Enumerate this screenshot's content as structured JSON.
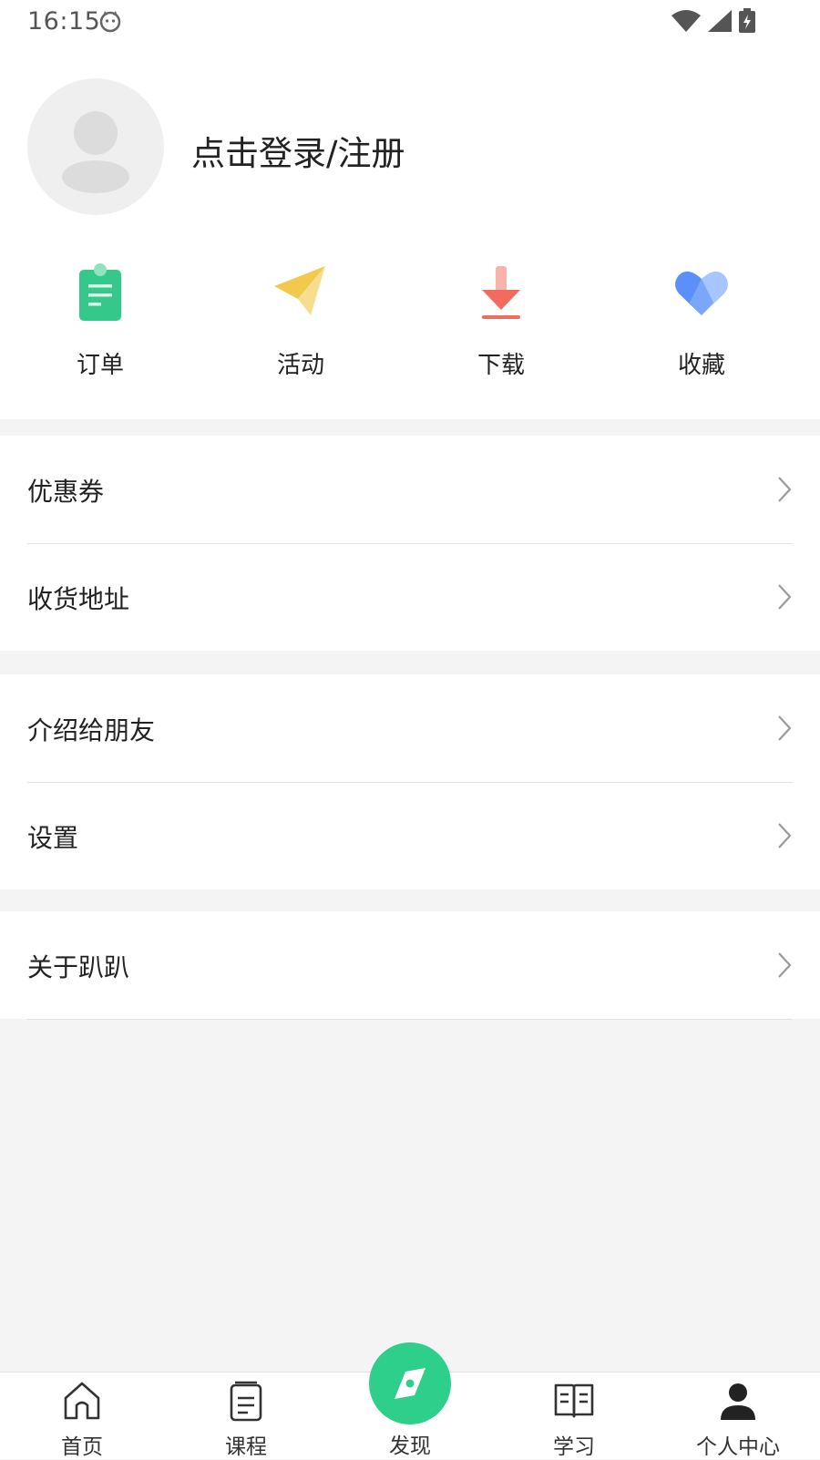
{
  "status_bar": {
    "time": "16:15"
  },
  "header": {
    "login_text": "点击登录/注册"
  },
  "quick_actions": [
    {
      "label": "订单",
      "icon": "order-clipboard-icon",
      "color": "#34c98a"
    },
    {
      "label": "活动",
      "icon": "paper-plane-icon",
      "color": "#f2c94c"
    },
    {
      "label": "下载",
      "icon": "download-icon",
      "color": "#f06c5f"
    },
    {
      "label": "收藏",
      "icon": "heart-icon",
      "color": "#5b8ff9"
    }
  ],
  "menu_groups": [
    {
      "items": [
        {
          "label": "优惠券"
        },
        {
          "label": "收货地址"
        }
      ]
    },
    {
      "items": [
        {
          "label": "介绍给朋友"
        },
        {
          "label": "设置"
        }
      ]
    },
    {
      "items": [
        {
          "label": "关于趴趴"
        }
      ]
    }
  ],
  "bottom_nav": [
    {
      "label": "首页",
      "icon": "home-icon"
    },
    {
      "label": "课程",
      "icon": "course-icon"
    },
    {
      "label": "发现",
      "icon": "compass-icon"
    },
    {
      "label": "学习",
      "icon": "book-icon"
    },
    {
      "label": "个人中心",
      "icon": "user-icon"
    }
  ],
  "colors": {
    "accent": "#2ecf8a",
    "background": "#f4f4f4"
  }
}
